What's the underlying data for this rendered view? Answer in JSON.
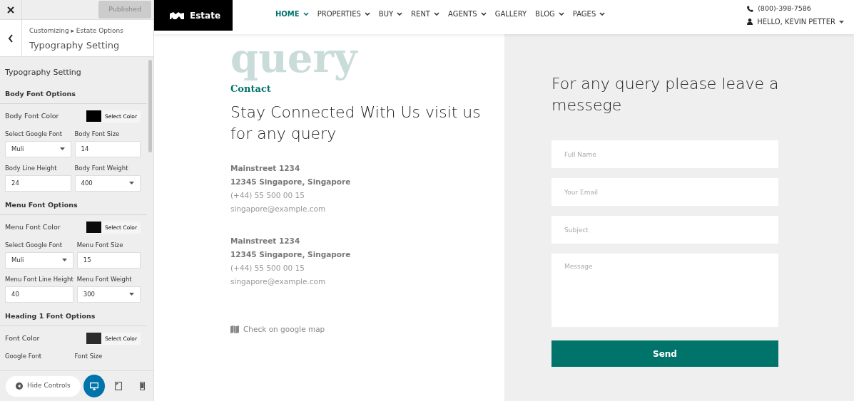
{
  "customizer": {
    "publish_button": {
      "label": "Published",
      "disabled": true
    },
    "breadcrumb": "Customizing ▸ Estate Options",
    "title": "Typography Setting",
    "section_title": "Typography Setting",
    "groups": [
      {
        "title": "Body Font Options",
        "color_label": "Body Font Color",
        "color": "#000000",
        "color_button": "Select Color",
        "fields": [
          {
            "label": "Select Google Font",
            "kind": "select",
            "value": "Muli"
          },
          {
            "label": "Body Font Size",
            "kind": "input",
            "value": "14"
          },
          {
            "label": "Body Line Height",
            "kind": "input",
            "value": "24"
          },
          {
            "label": "Body Font Weight",
            "kind": "select",
            "value": "400"
          }
        ]
      },
      {
        "title": "Menu Font Options",
        "color_label": "Menu Font Color",
        "color": "#0a0b0d",
        "color_button": "Select Color",
        "fields": [
          {
            "label": "Select Google Font",
            "kind": "select",
            "value": "Muli"
          },
          {
            "label": "Menu Font Size",
            "kind": "input",
            "value": "15"
          },
          {
            "label": "Menu Font Line Height",
            "kind": "input",
            "value": "40"
          },
          {
            "label": "Menu Font Weight",
            "kind": "select",
            "value": "300"
          }
        ]
      },
      {
        "title": "Heading 1 Font Options",
        "color_label": "Font Color",
        "color": "#2b2b2b",
        "color_button": "Select Color",
        "fields": [
          {
            "label": "Google Font",
            "kind": "label"
          },
          {
            "label": "Font Size",
            "kind": "label"
          }
        ]
      }
    ],
    "hide_controls": "Hide Controls",
    "devices": [
      {
        "kind": "desktop",
        "selected": true
      },
      {
        "kind": "tablet",
        "selected": false
      },
      {
        "kind": "mobile",
        "selected": false
      }
    ]
  },
  "site": {
    "brand": "Estate",
    "nav": [
      {
        "label": "HOME",
        "selected": true,
        "dropdown": true
      },
      {
        "label": "PROPERTIES",
        "selected": false,
        "dropdown": true
      },
      {
        "label": "BUY",
        "selected": false,
        "dropdown": true
      },
      {
        "label": "RENT",
        "selected": false,
        "dropdown": true
      },
      {
        "label": "AGENTS",
        "selected": false,
        "dropdown": true
      },
      {
        "label": "GALLERY",
        "selected": false,
        "dropdown": false
      },
      {
        "label": "BLOG",
        "selected": false,
        "dropdown": true
      },
      {
        "label": "PAGES",
        "selected": false,
        "dropdown": true
      }
    ],
    "phone": "(800)-398-7586",
    "user": "HELLO, KEVIN PETTER",
    "contact": {
      "background_word": "query",
      "eyebrow": "Contact",
      "heading": "Stay Connected With Us visit us for any query",
      "addresses": [
        [
          {
            "kind": "street",
            "text": "Mainstreet 1234"
          },
          {
            "kind": "city",
            "text": "12345 Singapore, Singapore"
          },
          {
            "kind": "phone",
            "text": "(+44) 55 500 00 15"
          },
          {
            "kind": "email",
            "text": "singapore@example.com"
          }
        ],
        [
          {
            "kind": "street",
            "text": "Mainstreet 1234"
          },
          {
            "kind": "city",
            "text": "12345 Singapore, Singapore"
          },
          {
            "kind": "phone",
            "text": "(+44) 55 500 00 15"
          },
          {
            "kind": "email",
            "text": "singapore@example.com"
          }
        ]
      ],
      "map_link": "Check on google map"
    },
    "form": {
      "heading": "For any query please leave a messege",
      "fields": [
        {
          "kind": "input",
          "placeholder": "Full Name"
        },
        {
          "kind": "input",
          "placeholder": "Your Email"
        },
        {
          "kind": "input",
          "placeholder": "Subject"
        },
        {
          "kind": "textarea",
          "placeholder": "Message"
        }
      ],
      "submit": "Send"
    }
  }
}
